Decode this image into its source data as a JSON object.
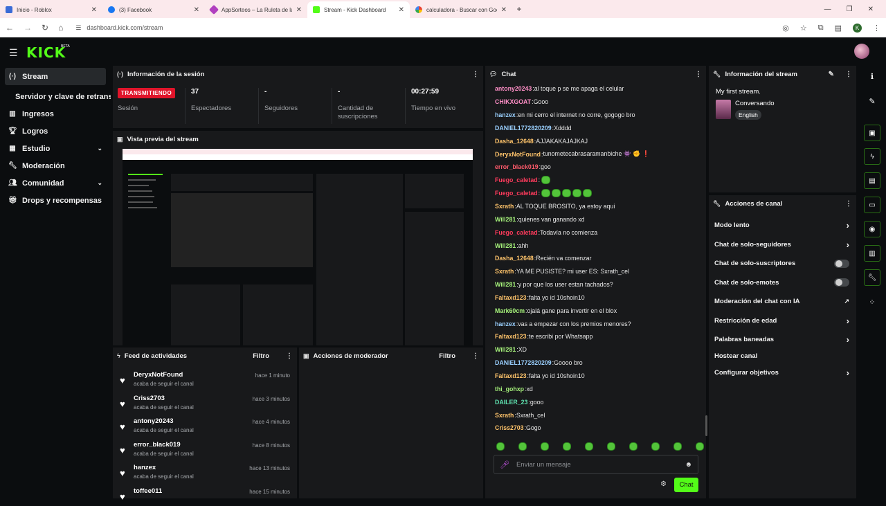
{
  "browser": {
    "tabs": [
      {
        "label": "Inicio - Roblox",
        "color": "#3a6bd6"
      },
      {
        "label": "(3) Facebook",
        "color": "#1877f2"
      },
      {
        "label": "AppSorteos – La Ruleta de la Su",
        "color": "#b13fbf"
      },
      {
        "label": "Stream - Kick Dashboard",
        "color": "#53fc18"
      },
      {
        "label": "calculadora - Buscar con Googl",
        "color": "#ea4335"
      }
    ],
    "url": "dashboard.kick.com/stream"
  },
  "brand": {
    "logo": "KICK",
    "beta": "BETA",
    "accent": "#53fc18"
  },
  "sidebar": {
    "items": [
      {
        "label": "Stream",
        "icon": "broadcast-icon"
      },
      {
        "label": "Servidor y clave de retransmisión"
      },
      {
        "label": "Ingresos",
        "icon": "chart-icon"
      },
      {
        "label": "Logros",
        "icon": "trophy-icon"
      },
      {
        "label": "Estudio",
        "icon": "studio-icon"
      },
      {
        "label": "Moderación",
        "icon": "wrench-icon"
      },
      {
        "label": "Comunidad",
        "icon": "users-icon"
      },
      {
        "label": "Drops y recompensas",
        "icon": "gift-icon"
      }
    ]
  },
  "session": {
    "title": "Información de la sesión",
    "status": "TRANSMITIENDO",
    "status_label": "Sesión",
    "viewers": "37",
    "viewers_label": "Espectadores",
    "followers": "-",
    "followers_label": "Seguidores",
    "subs": "-",
    "subs_label": "Cantidad de suscripciones",
    "uptime": "00:27:59",
    "uptime_label": "Tiempo en vivo"
  },
  "preview": {
    "title": "Vista previa del stream"
  },
  "feed": {
    "title": "Feed de actividades",
    "filter": "Filtro",
    "items": [
      {
        "name": "DeryxNotFound",
        "sub": "acaba de seguir el canal",
        "time": "hace 1 minuto"
      },
      {
        "name": "Criss2703",
        "sub": "acaba de seguir el canal",
        "time": "hace 3 minutos"
      },
      {
        "name": "antony20243",
        "sub": "acaba de seguir el canal",
        "time": "hace 4 minutos"
      },
      {
        "name": "error_black019",
        "sub": "acaba de seguir el canal",
        "time": "hace 8 minutos"
      },
      {
        "name": "hanzex",
        "sub": "acaba de seguir el canal",
        "time": "hace 13 minutos"
      },
      {
        "name": "toffee011",
        "sub": "",
        "time": "hace 15 minutos"
      }
    ]
  },
  "mod_actions": {
    "title": "Acciones de moderador",
    "filter": "Filtro"
  },
  "chat": {
    "title": "Chat",
    "messages": [
      {
        "user": "antony20243",
        "text": "al toque p se me apaga el celular",
        "color": "#ff8fc7"
      },
      {
        "user": "CHIKXGOAT",
        "text": "Gooo",
        "color": "#ff8fc7"
      },
      {
        "user": "hanzex",
        "text": "en mi cerro el internet no corre, gogogo bro",
        "color": "#9ad0ff"
      },
      {
        "user": "DANIEL1772820209",
        "text": "Xdddd",
        "color": "#9ad0ff"
      },
      {
        "user": "Dasha_12648",
        "text": "AJJAKAKAJAJKAJ",
        "color": "#ffc46b"
      },
      {
        "user": "DeryxNotFound",
        "text": "tunometecabrasaramanbiche 👾 ✊ ❗",
        "color": "#ffc46b"
      },
      {
        "user": "error_black019",
        "text": "goo",
        "color": "#ff5b6b"
      },
      {
        "user": "Fuego_caletad",
        "text": "",
        "color": "#ff3b5c",
        "emotes": 1
      },
      {
        "user": "Fuego_caletad",
        "text": "",
        "color": "#ff3b5c",
        "emotes": 5
      },
      {
        "user": "Sxrath",
        "text": "AL TOQUE BROSITO, ya estoy aqui",
        "color": "#ffc46b"
      },
      {
        "user": "Will281",
        "text": "quienes van ganando xd",
        "color": "#a6f27b"
      },
      {
        "user": "Fuego_caletad",
        "text": "Todavía no comienza",
        "color": "#ff3b5c"
      },
      {
        "user": "Will281",
        "text": "ahh",
        "color": "#a6f27b"
      },
      {
        "user": "Dasha_12648",
        "text": "Recién va comenzar",
        "color": "#ffc46b"
      },
      {
        "user": "Sxrath",
        "text": "YA ME PUSISTE? mi user ES: Sxrath_cel",
        "color": "#ffc46b"
      },
      {
        "user": "Will281",
        "text": "y por que los user estan tachados?",
        "color": "#a6f27b"
      },
      {
        "user": "Faltaxd123",
        "text": "falta yo id 10shoin10",
        "color": "#ffc46b"
      },
      {
        "user": "Mark60cm",
        "text": "ojalá gane para invertir en el blox",
        "color": "#a6f27b"
      },
      {
        "user": "hanzex",
        "text": "vas a empezar con los premios menores?",
        "color": "#9ad0ff"
      },
      {
        "user": "Faltaxd123",
        "text": "te escribi por Whatsapp",
        "color": "#ffc46b"
      },
      {
        "user": "Will281",
        "text": "XD",
        "color": "#a6f27b"
      },
      {
        "user": "DANIEL1772820209",
        "text": "Goooo bro",
        "color": "#9ad0ff"
      },
      {
        "user": "Faltaxd123",
        "text": "falta yo id 10shoin10",
        "color": "#ffc46b"
      },
      {
        "user": "thi_gohxp",
        "text": "xd",
        "color": "#a6f27b"
      },
      {
        "user": "DAILER_23",
        "text": "gooo",
        "color": "#5fe3b0"
      },
      {
        "user": "Sxrath",
        "text": "Sxrath_cel",
        "color": "#ffc46b"
      },
      {
        "user": "Criss2703",
        "text": "Gogo",
        "color": "#ffc46b"
      }
    ],
    "input_placeholder": "Enviar un mensaje",
    "send_label": "Chat"
  },
  "stream_info": {
    "title": "Información del stream",
    "stream_title": "My first stream.",
    "category": "Conversando",
    "language": "English"
  },
  "channel_actions": {
    "title": "Acciones de canal",
    "items": [
      {
        "label": "Modo lento",
        "control": "arrow"
      },
      {
        "label": "Chat de solo-seguidores",
        "control": "arrow"
      },
      {
        "label": "Chat de solo-suscriptores",
        "control": "toggle"
      },
      {
        "label": "Chat de solo-emotes",
        "control": "toggle"
      },
      {
        "label": "Moderación del chat con IA",
        "control": "external"
      },
      {
        "label": "Restricción de edad",
        "control": "arrow"
      },
      {
        "label": "Palabras baneadas",
        "control": "arrow"
      },
      {
        "label": "Hostear canal",
        "control": "none"
      },
      {
        "label": "Configurar objetivos",
        "control": "arrow"
      }
    ]
  }
}
